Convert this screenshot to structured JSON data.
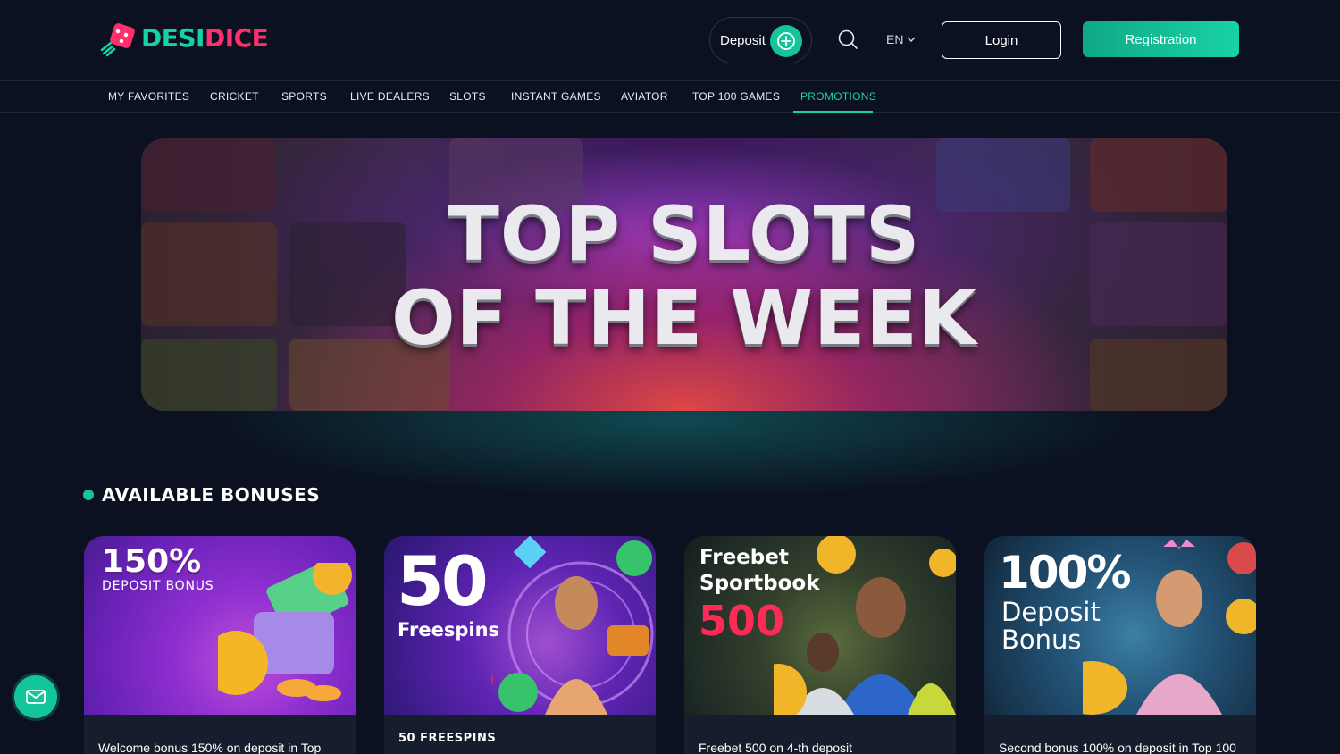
{
  "brand": {
    "name_part1": "DESI",
    "name_part2": "DICE",
    "accent": "#14d3a2",
    "secondary": "#ff2f6d"
  },
  "header": {
    "deposit_label": "Deposit",
    "language": "EN",
    "login_label": "Login",
    "registration_label": "Registration"
  },
  "nav": {
    "items": [
      {
        "label": "MY FAVORITES"
      },
      {
        "label": "CRICKET"
      },
      {
        "label": "SPORTS"
      },
      {
        "label": "LIVE DEALERS"
      },
      {
        "label": "SLOTS"
      },
      {
        "label": "INSTANT GAMES"
      },
      {
        "label": "AVIATOR"
      },
      {
        "label": "TOP 100 GAMES"
      },
      {
        "label": "PROMOTIONS",
        "active": true
      }
    ]
  },
  "banner": {
    "line1": "TOP SLOTS",
    "line2": "OF THE WEEK"
  },
  "bonuses": {
    "title": "AVAILABLE BONUSES",
    "cards": [
      {
        "img_line1": "150%",
        "img_line2": "DEPOSIT BONUS",
        "text": "Welcome bonus 150% on deposit in Top"
      },
      {
        "img_line1": "50",
        "img_line2": "Freespins",
        "text": "50 FREESPINS"
      },
      {
        "img_line1": "Freebet",
        "img_line2": "Sportbook",
        "img_line3": "500",
        "text": "Freebet 500 on 4-th deposit"
      },
      {
        "img_line1": "100%",
        "img_line2": "Deposit",
        "img_line3": "Bonus",
        "text": "Second bonus 100% on deposit in Top 100"
      }
    ]
  },
  "icons": {
    "search": "search-icon",
    "chat": "mail-chat-icon",
    "deposit": "plus-circle-icon"
  }
}
